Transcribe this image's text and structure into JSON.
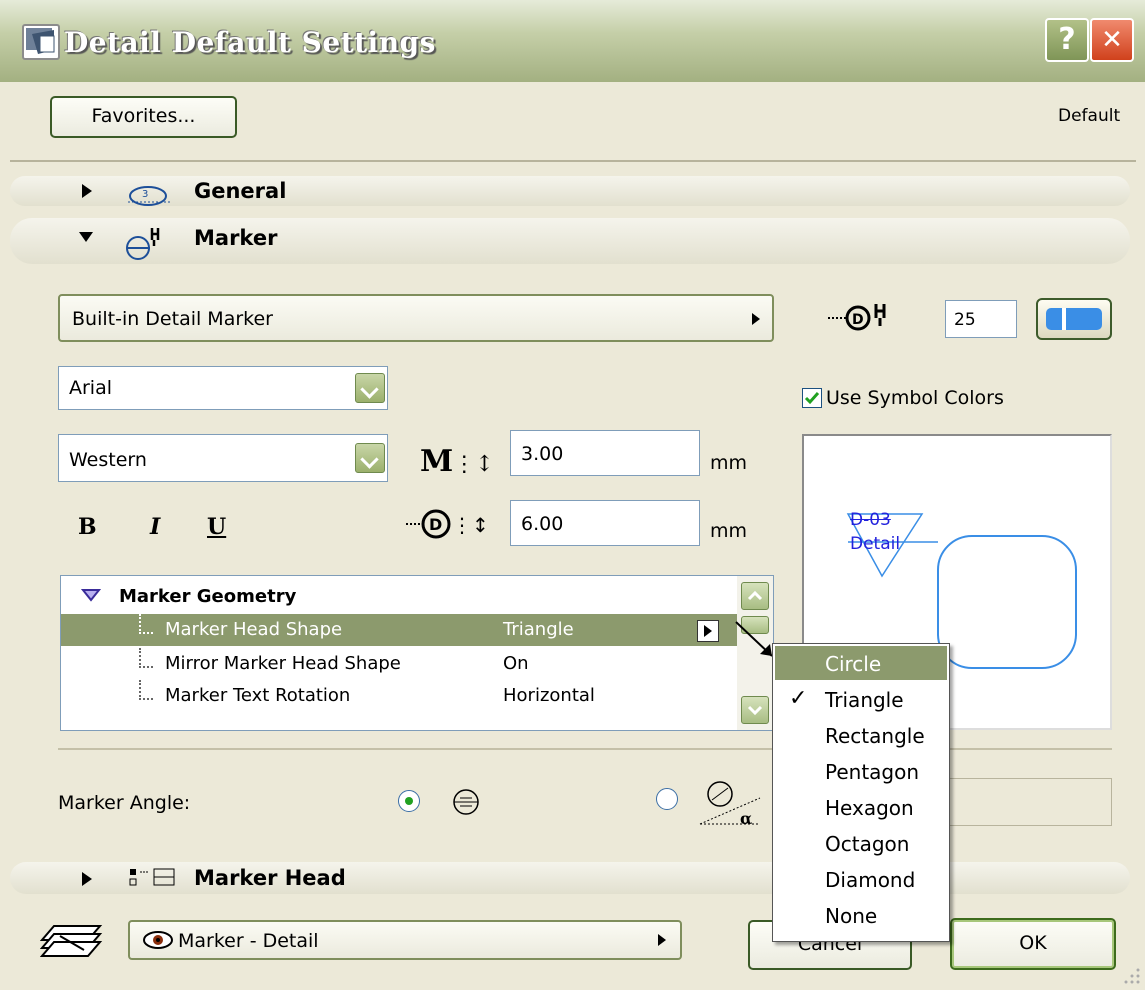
{
  "window": {
    "title": "Detail Default Settings",
    "help_label": "?",
    "close_label": "✕"
  },
  "top": {
    "favorites_label": "Favorites...",
    "default_label": "Default"
  },
  "sections": {
    "general_label": "General",
    "marker_label": "Marker",
    "marker_head_label": "Marker Head"
  },
  "marker": {
    "type_value": "Built-in Detail Marker",
    "pen_value": "25",
    "font_value": "Arial",
    "script_value": "Western",
    "text_size": "3.00",
    "text_size_unit": "mm",
    "marker_size": "6.00",
    "marker_size_unit": "mm",
    "bold_label": "B",
    "italic_label": "I",
    "underline_label": "U",
    "use_symbol_colors_label": "Use Symbol Colors",
    "use_symbol_colors_checked": true,
    "size_icon_label": "M"
  },
  "geometry": {
    "header": "Marker Geometry",
    "rows": [
      {
        "name": "Marker Head Shape",
        "value": "Triangle"
      },
      {
        "name": "Mirror Marker Head Shape",
        "value": "On"
      },
      {
        "name": "Marker Text Rotation",
        "value": "Horizontal"
      }
    ]
  },
  "shape_menu": {
    "items": [
      "Circle",
      "Triangle",
      "Rectangle",
      "Pentagon",
      "Hexagon",
      "Octagon",
      "Diamond",
      "None"
    ],
    "highlighted": "Circle",
    "checked": "Triangle"
  },
  "preview": {
    "marker_id": "D-03",
    "marker_name": "Detail"
  },
  "angle": {
    "label": "Marker Angle:"
  },
  "bottom": {
    "layer_value": "Marker - Detail",
    "cancel_label": "Cancel",
    "ok_label": "OK"
  },
  "colors": {
    "title_gradient": "#a3b081",
    "highlight": "#8c9a6d",
    "accent_blue": "#3a8ee6"
  }
}
